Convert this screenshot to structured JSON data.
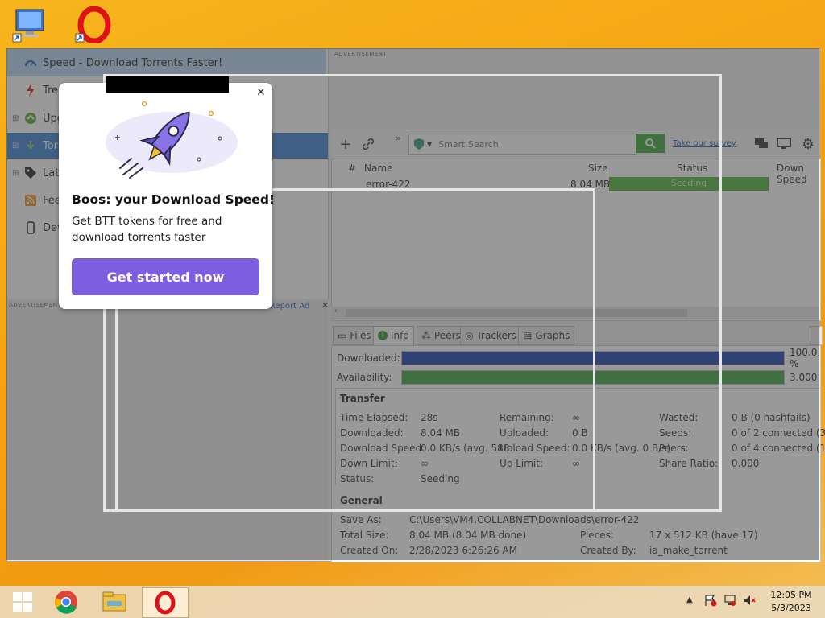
{
  "window": {
    "title": "Speed - Download Torrents Faster!"
  },
  "sidebar": {
    "items": [
      {
        "label": "Trending"
      },
      {
        "label": "Upgrade"
      },
      {
        "label": "Torrents"
      },
      {
        "label": "Labels"
      },
      {
        "label": "Feeds"
      },
      {
        "label": "Devices"
      }
    ],
    "ad_label": "ADVERTISEMENT",
    "report_ad": "Report Ad"
  },
  "ad_top_label": "ADVERTISEMENT",
  "toolbar": {
    "search_placeholder": "Smart Search",
    "survey_link": "Take our survey"
  },
  "torrent_list": {
    "columns": [
      "#",
      "Name",
      "Size",
      "Status",
      "Down Speed"
    ],
    "rows": [
      {
        "name": "error-422",
        "size": "8.04 MB",
        "status": "Seeding"
      }
    ]
  },
  "detail_tabs": [
    "Files",
    "Info",
    "Peers",
    "Trackers",
    "Graphs"
  ],
  "info": {
    "downloaded_label": "Downloaded:",
    "downloaded_value": "100.0 %",
    "downloaded_fraction": 1.0,
    "availability_label": "Availability:",
    "availability_value": "3.000",
    "availability_fraction": 1.0,
    "transfer_title": "Transfer",
    "transfer": {
      "time_elapsed_label": "Time Elapsed:",
      "time_elapsed": "28s",
      "remaining_label": "Remaining:",
      "remaining": "∞",
      "wasted_label": "Wasted:",
      "wasted": "0 B (0 hashfails)",
      "downloaded_label": "Downloaded:",
      "downloaded": "8.04 MB",
      "uploaded_label": "Uploaded:",
      "uploaded": "0 B",
      "seeds_label": "Seeds:",
      "seeds": "0 of 2 connected (3",
      "download_speed_label": "Download Speed:",
      "download_speed": "0.0 KB/s (avg. 588.",
      "upload_speed_label": "Upload Speed:",
      "upload_speed": "0.0 KB/s (avg. 0 B/s)",
      "peers_label": "Peers:",
      "peers": "0 of 4 connected (1",
      "down_limit_label": "Down Limit:",
      "down_limit": "∞",
      "up_limit_label": "Up Limit:",
      "up_limit": "∞",
      "share_ratio_label": "Share Ratio:",
      "share_ratio": "0.000",
      "status_label": "Status:",
      "status": "Seeding"
    },
    "general_title": "General",
    "general": {
      "save_as_label": "Save As:",
      "save_as": "C:\\Users\\VM4.COLLABNET\\Downloads\\error-422",
      "total_size_label": "Total Size:",
      "total_size": "8.04 MB (8.04 MB done)",
      "pieces_label": "Pieces:",
      "pieces": "17 x 512 KB (have 17)",
      "created_on_label": "Created On:",
      "created_on": "2/28/2023 6:26:26 AM",
      "created_by_label": "Created By:",
      "created_by": "ia_make_torrent"
    }
  },
  "popup": {
    "title": "Boos: your Download Speed!",
    "body": "Get BTT tokens for free and download torrents faster",
    "cta": "Get started now"
  },
  "taskbar": {
    "time": "12:05 PM",
    "date": "5/3/2023"
  },
  "colors": {
    "accent_purple": "#7b5fe0",
    "seed_green": "#3aa33a",
    "selection_blue": "#3b7fd1"
  }
}
